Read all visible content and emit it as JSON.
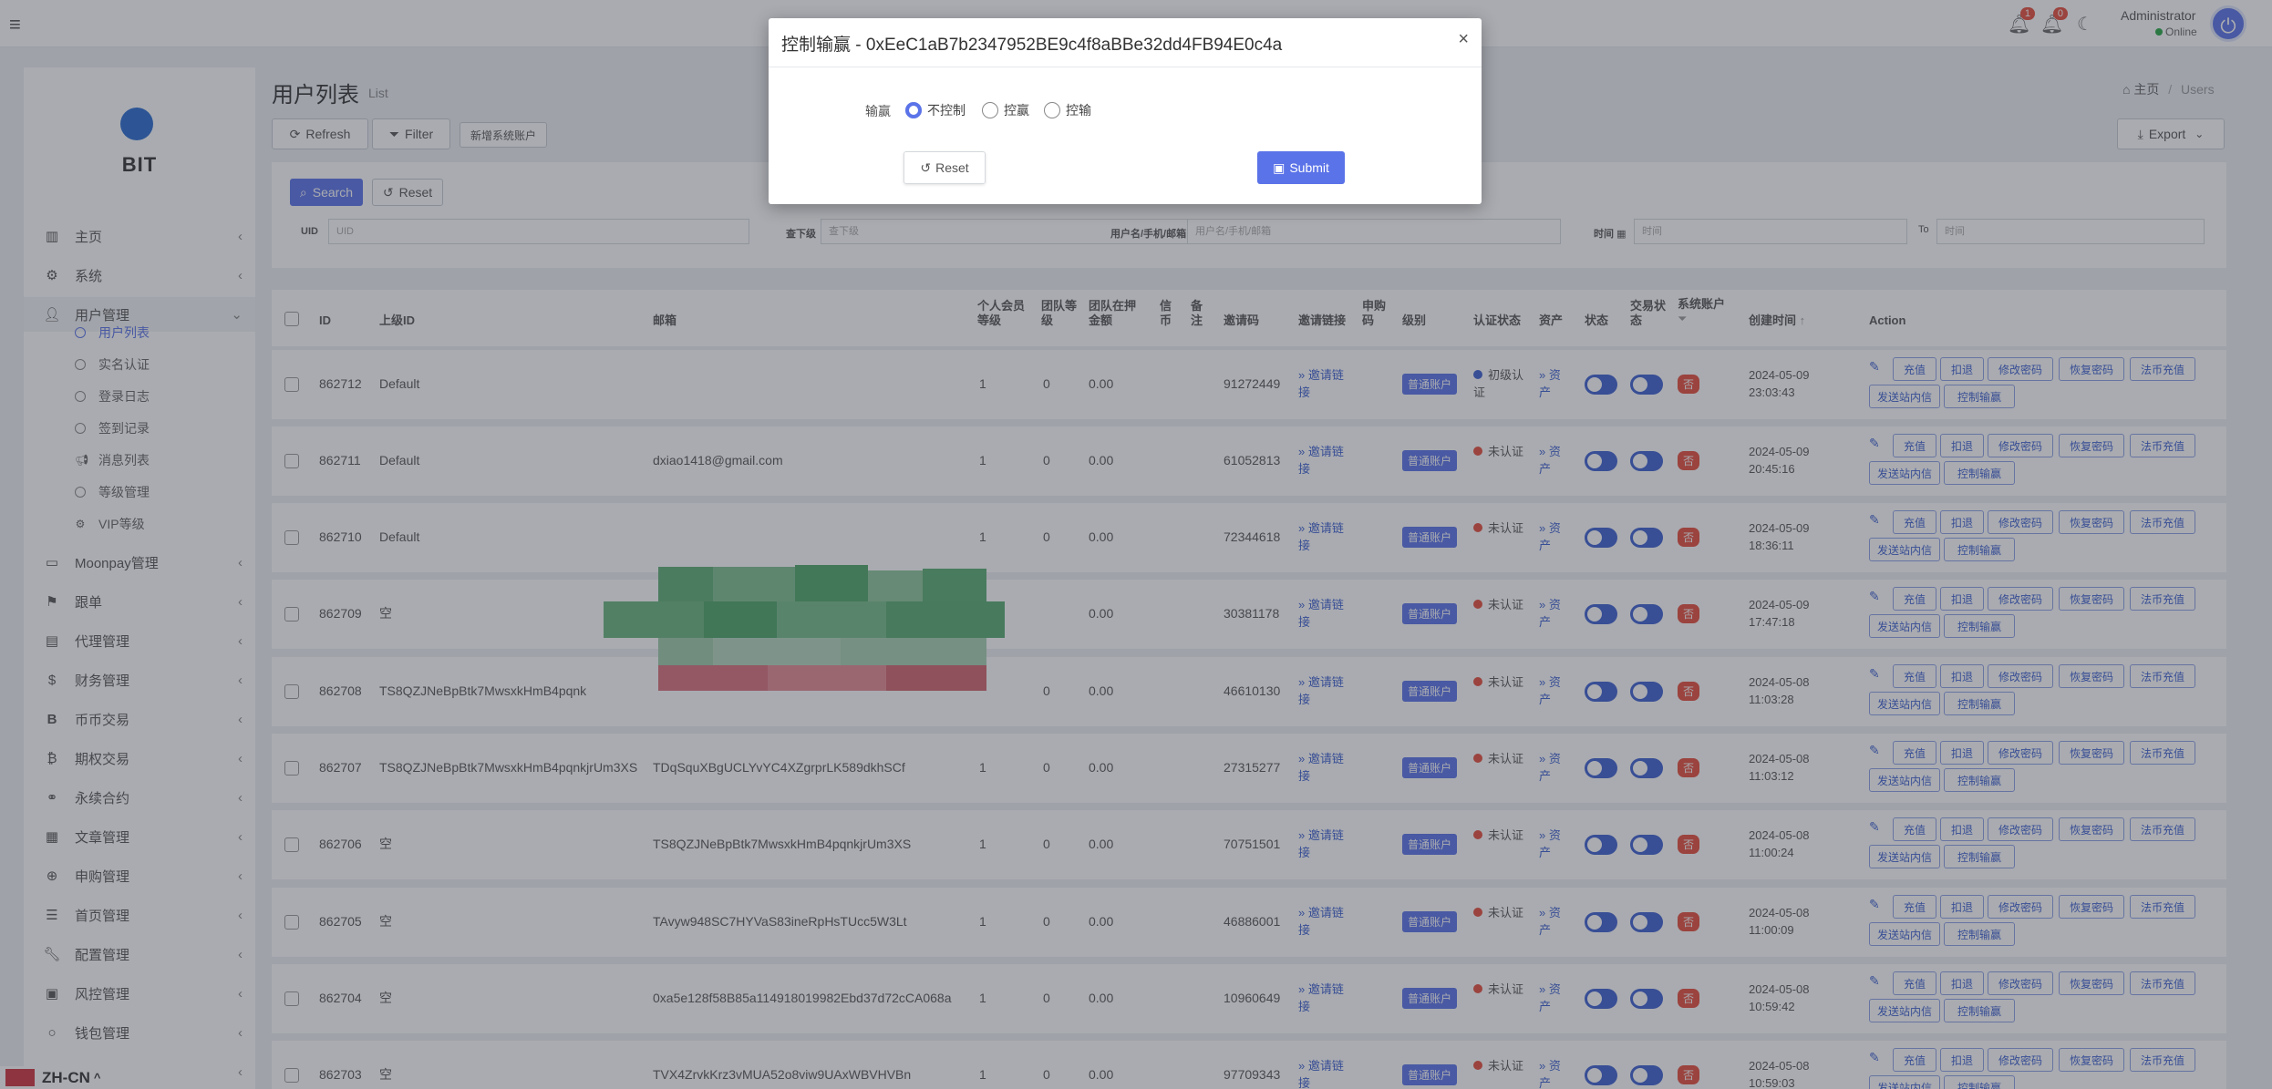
{
  "header": {
    "badge1": "1",
    "badge2": "0",
    "admin_name": "Administrator",
    "admin_status": "Online"
  },
  "sidebar": {
    "brand": "BIT",
    "items": [
      {
        "label": "主页",
        "icon": "dashboard-icon"
      },
      {
        "label": "系统",
        "icon": "gear-icon"
      },
      {
        "label": "用户管理",
        "icon": "user-icon"
      },
      {
        "label": "Moonpay管理",
        "icon": "card-icon"
      },
      {
        "label": "跟单",
        "icon": "flag-icon"
      },
      {
        "label": "代理管理",
        "icon": "id-card-icon"
      },
      {
        "label": "财务管理",
        "icon": "dollar-icon"
      },
      {
        "label": "币币交易",
        "icon": "bitcoin-icon"
      },
      {
        "label": "期权交易",
        "icon": "bitcoin-icon"
      },
      {
        "label": "永续合约",
        "icon": "link-icon"
      },
      {
        "label": "文章管理",
        "icon": "newspaper-icon"
      },
      {
        "label": "申购管理",
        "icon": "globe-icon"
      },
      {
        "label": "首页管理",
        "icon": "list-icon"
      },
      {
        "label": "配置管理",
        "icon": "wrench-icon"
      },
      {
        "label": "风控管理",
        "icon": "chart-icon"
      },
      {
        "label": "钱包管理",
        "icon": "circle-icon"
      }
    ],
    "subitems": [
      {
        "label": "用户列表"
      },
      {
        "label": "实名认证"
      },
      {
        "label": "登录日志"
      },
      {
        "label": "签到记录"
      },
      {
        "label": "消息列表"
      },
      {
        "label": "等级管理"
      },
      {
        "label": "VIP等级"
      }
    ]
  },
  "lang": "ZH-CN",
  "page": {
    "title": "用户列表",
    "subtitle": "List",
    "breadcrumb_home": "主页",
    "breadcrumb_current": "Users",
    "refresh_label": "Refresh",
    "filter_label": "Filter",
    "new_system_account_label": "新增系统账户",
    "export_label": "Export"
  },
  "search": {
    "search_label": "Search",
    "reset_label": "Reset",
    "uid_label": "UID",
    "uid_placeholder": "UID",
    "downline_label": "查下级",
    "downline_placeholder": "查下级",
    "username_label": "用户名/手机/邮箱",
    "username_placeholder": "用户名/手机/邮箱",
    "time_label": "时间",
    "time_start_placeholder": "时间",
    "time_to": "To",
    "time_end_placeholder": "时间"
  },
  "table": {
    "headers": {
      "id": "ID",
      "parent_id": "上级ID",
      "email": "邮箱",
      "member_level": "个人会员等级",
      "team_level": "团队等级",
      "team_stake": "团队在押金额",
      "credit": "信币",
      "note": "备注",
      "invite_code": "邀请码",
      "invite_link": "邀请链接",
      "purchase_code": "申购码",
      "level": "级别",
      "auth_status": "认证状态",
      "assets": "资产",
      "status": "状态",
      "trade_status": "交易状态",
      "system_account": "系统账户",
      "created_at": "创建时间",
      "action": "Action"
    },
    "invite_link_text": "邀请链接",
    "assets_text": "资产",
    "type_tag": "普通账户",
    "system_tag": "否",
    "actions": [
      "充值",
      "扣退",
      "修改密码",
      "恢复密码",
      "法币充值",
      "发送站内信",
      "控制输赢"
    ],
    "rows": [
      {
        "id": "862712",
        "parent": "Default",
        "email": "",
        "member_level": "1",
        "team_level": "0",
        "stake": "0.00",
        "invite": "91272449",
        "auth": "初级认证",
        "auth_color": "blue",
        "date": "2024-05-09",
        "time": "23:03:43"
      },
      {
        "id": "862711",
        "parent": "Default",
        "email": "dxiao1418@gmail.com",
        "member_level": "1",
        "team_level": "0",
        "stake": "0.00",
        "invite": "61052813",
        "auth": "未认证",
        "auth_color": "red",
        "date": "2024-05-09",
        "time": "20:45:16"
      },
      {
        "id": "862710",
        "parent": "Default",
        "email": "",
        "member_level": "1",
        "team_level": "0",
        "stake": "0.00",
        "invite": "72344618",
        "auth": "未认证",
        "auth_color": "red",
        "date": "2024-05-09",
        "time": "18:36:11"
      },
      {
        "id": "862709",
        "parent": "空",
        "email": "",
        "member_level": "",
        "team_level": "",
        "stake": "0.00",
        "invite": "30381178",
        "auth": "未认证",
        "auth_color": "red",
        "date": "2024-05-09",
        "time": "17:47:18"
      },
      {
        "id": "862708",
        "parent": "TS8QZJNeBpBtk7MwsxkHmB4pqnk",
        "email": "",
        "member_level": "",
        "team_level": "0",
        "stake": "0.00",
        "invite": "46610130",
        "auth": "未认证",
        "auth_color": "red",
        "date": "2024-05-08",
        "time": "11:03:28"
      },
      {
        "id": "862707",
        "parent": "TS8QZJNeBpBtk7MwsxkHmB4pqnkjrUm3XS",
        "email": "TDqSquXBgUCLYvYC4XZgrprLK589dkhSCf",
        "member_level": "1",
        "team_level": "0",
        "stake": "0.00",
        "invite": "27315277",
        "auth": "未认证",
        "auth_color": "red",
        "date": "2024-05-08",
        "time": "11:03:12"
      },
      {
        "id": "862706",
        "parent": "空",
        "email": "TS8QZJNeBpBtk7MwsxkHmB4pqnkjrUm3XS",
        "member_level": "1",
        "team_level": "0",
        "stake": "0.00",
        "invite": "70751501",
        "auth": "未认证",
        "auth_color": "red",
        "date": "2024-05-08",
        "time": "11:00:24"
      },
      {
        "id": "862705",
        "parent": "空",
        "email": "TAvyw948SC7HYVaS83ineRpHsTUcc5W3Lt",
        "member_level": "1",
        "team_level": "0",
        "stake": "0.00",
        "invite": "46886001",
        "auth": "未认证",
        "auth_color": "red",
        "date": "2024-05-08",
        "time": "11:00:09"
      },
      {
        "id": "862704",
        "parent": "空",
        "email": "0xa5e128f58B85a114918019982Ebd37d72cCA068a",
        "member_level": "1",
        "team_level": "0",
        "stake": "0.00",
        "invite": "10960649",
        "auth": "未认证",
        "auth_color": "red",
        "date": "2024-05-08",
        "time": "10:59:42"
      },
      {
        "id": "862703",
        "parent": "空",
        "email": "TVX4ZrvkKrz3vMUA52o8viw9UAxWBVHVBn",
        "member_level": "1",
        "team_level": "0",
        "stake": "0.00",
        "invite": "97709343",
        "auth": "未认证",
        "auth_color": "red",
        "date": "2024-05-08",
        "time": "10:59:03"
      }
    ]
  },
  "modal": {
    "title": "控制输赢 - 0xEeC1aB7b2347952BE9c4f8aBBe32dd4FB94E0c4a",
    "close": "×",
    "field_label": "输赢",
    "options": [
      "不控制",
      "控赢",
      "控输"
    ],
    "selected": "不控制",
    "reset_label": "Reset",
    "submit_label": "Submit"
  },
  "colors": {
    "accent": "#5b73e8",
    "danger": "#e74c3c",
    "overlay": "rgba(50,56,66,0.42)"
  }
}
